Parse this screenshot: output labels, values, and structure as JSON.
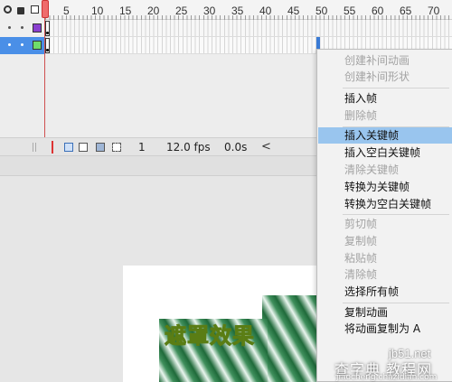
{
  "timeline": {
    "ruler_labels": [
      "5",
      "10",
      "15",
      "20",
      "25",
      "30",
      "35",
      "40",
      "45",
      "50",
      "55",
      "60",
      "65",
      "70"
    ],
    "layers": [
      {
        "swatch_color": "#8a3fd0"
      },
      {
        "swatch_color": "#6fdc6a"
      }
    ],
    "status": {
      "current_frame": "1",
      "fps": "12.0 fps",
      "time": "0.0s",
      "scroll_left": "<"
    }
  },
  "stage": {
    "title_text": "遮罩效果"
  },
  "context_menu": {
    "items": [
      {
        "label": "创建补间动画",
        "enabled": false
      },
      {
        "label": "创建补间形状",
        "enabled": false
      },
      {
        "label": "插入帧",
        "enabled": true
      },
      {
        "label": "删除帧",
        "enabled": false
      },
      {
        "label": "插入关键帧",
        "enabled": true,
        "highlighted": true
      },
      {
        "label": "插入空白关键帧",
        "enabled": true
      },
      {
        "label": "清除关键帧",
        "enabled": false
      },
      {
        "label": "转换为关键帧",
        "enabled": true
      },
      {
        "label": "转换为空白关键帧",
        "enabled": true
      },
      {
        "label": "剪切帧",
        "enabled": false
      },
      {
        "label": "复制帧",
        "enabled": false
      },
      {
        "label": "粘贴帧",
        "enabled": false
      },
      {
        "label": "清除帧",
        "enabled": false
      },
      {
        "label": "选择所有帧",
        "enabled": true
      },
      {
        "label": "复制动画",
        "enabled": true
      },
      {
        "label": "将动画复制为 A",
        "enabled": true
      }
    ]
  },
  "watermark": {
    "site": "jb51.net",
    "cn": "查字典 教程网",
    "url": "jiaocheng.chazidian.com"
  }
}
